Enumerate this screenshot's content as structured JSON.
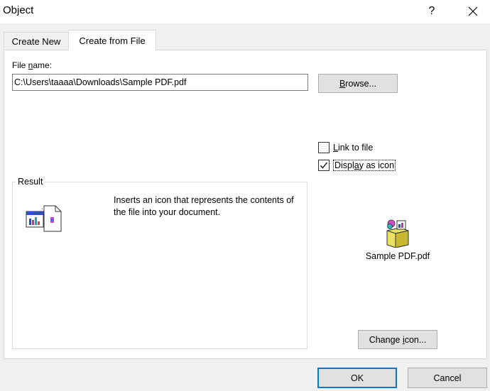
{
  "window": {
    "title": "Object",
    "help_glyph": "?"
  },
  "tabs": [
    {
      "label": "Create New",
      "active": false
    },
    {
      "label": "Create from File",
      "active": true
    }
  ],
  "file_name": {
    "label_prefix": "File ",
    "label_accel": "n",
    "label_suffix": "ame:",
    "value": "C:\\Users\\taaaa\\Downloads\\Sample PDF.pdf"
  },
  "browse_button": {
    "accel": "B",
    "rest": "rowse..."
  },
  "options": {
    "link_to_file": {
      "accel": "L",
      "rest": "ink to file",
      "checked": false
    },
    "display_as_icon": {
      "before": "Displ",
      "accel": "a",
      "rest": "y as icon",
      "checked": true
    }
  },
  "result": {
    "legend": "Result",
    "text": "Inserts an icon that represents the contents of the file into your document."
  },
  "icon_preview": {
    "caption": "Sample PDF.pdf",
    "icon": "package-icon"
  },
  "change_icon_button": {
    "before": "Change ",
    "accel": "i",
    "rest": "con..."
  },
  "ok_button": "OK",
  "cancel_button": "Cancel"
}
